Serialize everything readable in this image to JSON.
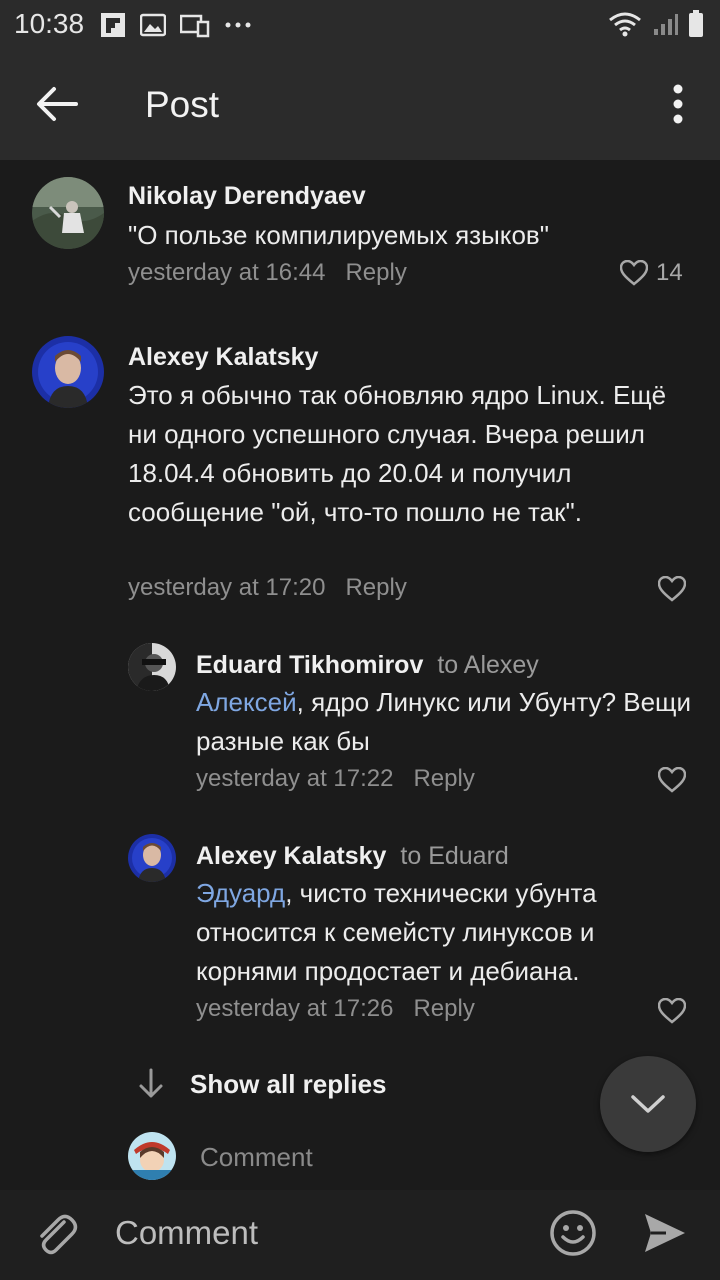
{
  "status_bar": {
    "time": "10:38"
  },
  "header": {
    "title": "Post"
  },
  "comments": [
    {
      "author": "Nikolay Derendyaev",
      "text": "\"О пользе компилируемых языков\"",
      "time": "yesterday at 16:44",
      "reply_label": "Reply",
      "likes": "14"
    },
    {
      "author": "Alexey Kalatsky",
      "text": "Это я обычно так обновляю ядро Linux. Ещё ни одного успешного случая. Вчера решил 18.04.4 обновить до 20.04 и получил сообщение \"ой, что-то пошло не так\".",
      "time": "yesterday at 17:20",
      "reply_label": "Reply"
    }
  ],
  "replies": [
    {
      "author": "Eduard Tikhomirov",
      "to": "to Alexey",
      "mention": "Алексей",
      "text": ", ядро Линукс или Убунту? Вещи разные как бы",
      "time": "yesterday at 17:22",
      "reply_label": "Reply"
    },
    {
      "author": "Alexey Kalatsky",
      "to": "to Eduard",
      "mention": "Эдуард",
      "text": ", чисто технически убунта относится к семейсту линуксов и корнями продостает и дебиана.",
      "time": "yesterday at 17:26",
      "reply_label": "Reply"
    }
  ],
  "show_all_replies": "Show all replies",
  "mini_comment": {
    "placeholder": "Comment"
  },
  "input_bar": {
    "placeholder": "Comment"
  },
  "colors": {
    "background": "#1b1b1b",
    "header": "#2b2b2b",
    "mention": "#7fa7e2",
    "meta": "#8f8f8f"
  }
}
